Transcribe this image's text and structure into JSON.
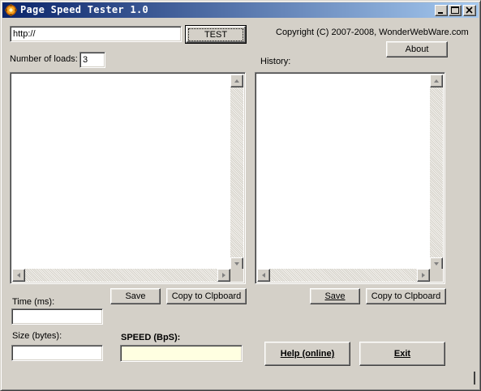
{
  "window": {
    "title": "Page Speed Tester 1.0",
    "icon": "gear-icon",
    "title_bar_colors": [
      "#0a246a",
      "#a6caf0"
    ]
  },
  "url": {
    "value": "http://"
  },
  "test_button": {
    "label": "TEST"
  },
  "copyright": "Copyright (C) 2007-2008, WonderWebWare.com",
  "about_button": {
    "label": "About"
  },
  "loads": {
    "label": "Number of loads:",
    "value": "3"
  },
  "history": {
    "label": "History:"
  },
  "results_panel": {
    "save_label": "Save",
    "copy_label": "Copy to Clpboard"
  },
  "history_panel": {
    "save_label": "Save",
    "copy_label": "Copy to Clpboard"
  },
  "time": {
    "label": "Time (ms):",
    "value": ""
  },
  "size": {
    "label": "Size (bytes):",
    "value": ""
  },
  "speed": {
    "label": "SPEED (BpS):",
    "value": "",
    "field_color": "#ffffe1"
  },
  "help_button": {
    "label": "Help (online)"
  },
  "exit_button": {
    "label": "Exit"
  }
}
